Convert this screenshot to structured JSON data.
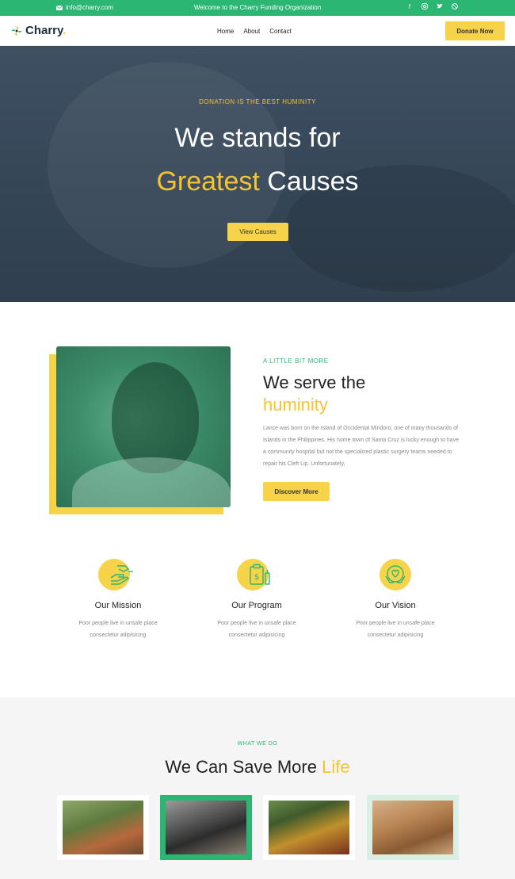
{
  "topbar": {
    "email": "info@charry.com",
    "welcome": "Welcome to the Charry Funding Organization",
    "socials": [
      "facebook-icon",
      "instagram-icon",
      "twitter-icon",
      "dribbble-icon"
    ]
  },
  "nav": {
    "logo": "Charry",
    "logo_dot": ".",
    "items": [
      "Home",
      "About",
      "Contact"
    ],
    "donate": "Donate Now"
  },
  "hero": {
    "tagline": "DONATION IS THE BEST HUMINITY",
    "line1": "We stands for",
    "line2_accent": "Greatest",
    "line2_rest": " Causes",
    "button": "View Causes"
  },
  "about": {
    "kicker": "A LITTLE BIT MORE",
    "title_line1": "We serve the",
    "title_line2": "huminity",
    "text": "Lance was born on the Island of Occidental Mindoro, one of many thousands of Islands in the Philippines. His home town of Santa Cruz is lucky enough to have a community hospital but not the specialized plastic surgery teams needed to repair his Cleft Lip. Unfortunately,",
    "button": "Discover More"
  },
  "features": [
    {
      "icon": "helping-hands-icon",
      "title": "Our Mission",
      "desc_line1": "Poor people live in unsafe place",
      "desc_line2": "consectetur adipisicing"
    },
    {
      "icon": "clipboard-money-icon",
      "title": "Our Program",
      "desc_line1": "Poor people live in unsafe place",
      "desc_line2": "consectetur adipisicing"
    },
    {
      "icon": "heart-hands-icon",
      "title": "Our Vision",
      "desc_line1": "Poor people live in unsafe place",
      "desc_line2": "consectetur adipisicing"
    }
  ],
  "what_we_do": {
    "kicker": "WHAT WE DO",
    "title_main": "We Can Save More ",
    "title_accent": "Life"
  },
  "colors": {
    "green": "#2bb673",
    "yellow": "#f7d34a",
    "hero_dark": "#354657"
  }
}
